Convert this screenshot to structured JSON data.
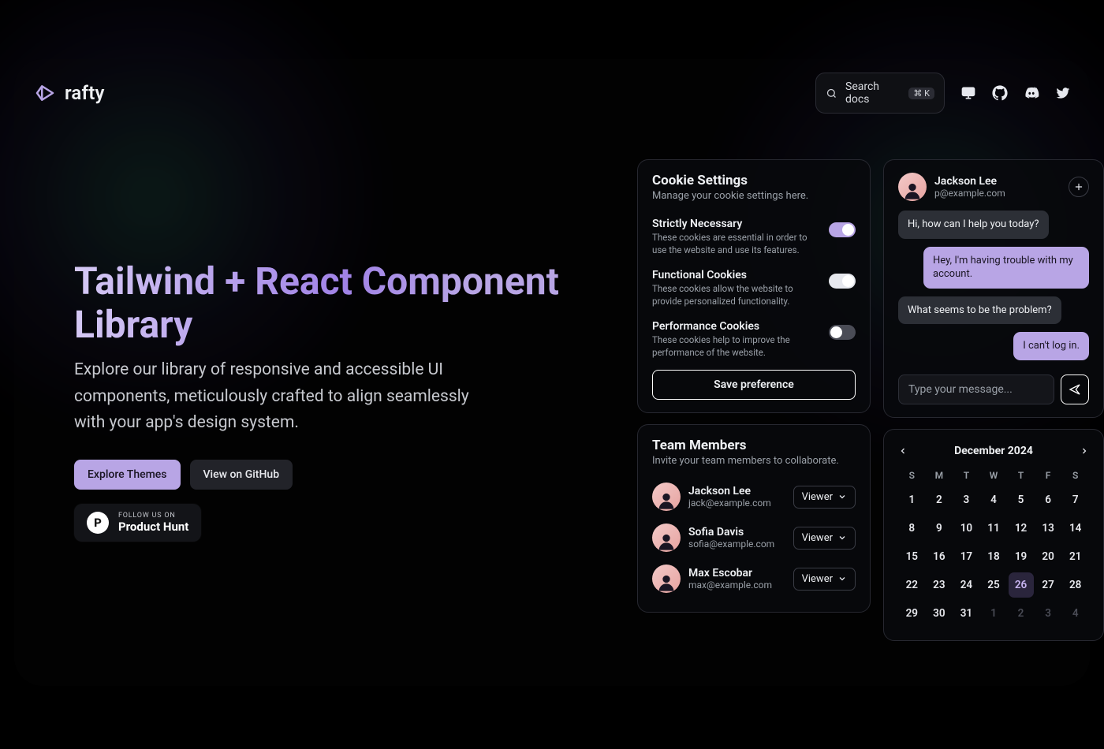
{
  "brand": {
    "name": "rafty"
  },
  "search": {
    "placeholder": "Search docs",
    "shortcut": "⌘ K"
  },
  "hero": {
    "title": "Tailwind + React Component Library",
    "subtitle": "Explore our library of responsive and accessible UI components, meticulously crafted to align seamlessly with your app's design system.",
    "primary_btn": "Explore Themes",
    "secondary_btn": "View on GitHub",
    "ph_follow": "FOLLOW US ON",
    "ph_name": "Product Hunt"
  },
  "cookies": {
    "title": "Cookie Settings",
    "subtitle": "Manage your cookie settings here.",
    "items": [
      {
        "name": "Strictly Necessary",
        "desc": "These cookies are essential in order to use the website and use its features.",
        "on": true,
        "accent": true
      },
      {
        "name": "Functional Cookies",
        "desc": "These cookies allow the website to provide personalized functionality.",
        "on": true,
        "accent": false
      },
      {
        "name": "Performance Cookies",
        "desc": "These cookies help to improve the performance of the website.",
        "on": false,
        "accent": false
      }
    ],
    "save": "Save preference"
  },
  "team": {
    "title": "Team Members",
    "subtitle": "Invite your team members to collaborate.",
    "role_label": "Viewer",
    "members": [
      {
        "name": "Jackson Lee",
        "email": "jack@example.com"
      },
      {
        "name": "Sofia Davis",
        "email": "sofia@example.com"
      },
      {
        "name": "Max Escobar",
        "email": "max@example.com"
      }
    ]
  },
  "chat": {
    "user_name": "Jackson Lee",
    "user_email": "p@example.com",
    "messages": [
      {
        "side": "left",
        "text": "Hi, how can I help you today?"
      },
      {
        "side": "right",
        "text": "Hey, I'm having trouble with my account."
      },
      {
        "side": "left",
        "text": "What seems to be the problem?"
      },
      {
        "side": "right",
        "text": "I can't log in."
      }
    ],
    "input_placeholder": "Type your message..."
  },
  "calendar": {
    "label": "December 2024",
    "dow": [
      "S",
      "M",
      "T",
      "W",
      "T",
      "F",
      "S"
    ],
    "weeks": [
      [
        {
          "d": 1
        },
        {
          "d": 2
        },
        {
          "d": 3
        },
        {
          "d": 4
        },
        {
          "d": 5
        },
        {
          "d": 6
        },
        {
          "d": 7
        }
      ],
      [
        {
          "d": 8
        },
        {
          "d": 9
        },
        {
          "d": 10
        },
        {
          "d": 11
        },
        {
          "d": 12
        },
        {
          "d": 13
        },
        {
          "d": 14
        }
      ],
      [
        {
          "d": 15
        },
        {
          "d": 16
        },
        {
          "d": 17
        },
        {
          "d": 18
        },
        {
          "d": 19
        },
        {
          "d": 20
        },
        {
          "d": 21
        }
      ],
      [
        {
          "d": 22
        },
        {
          "d": 23
        },
        {
          "d": 24
        },
        {
          "d": 25
        },
        {
          "d": 26,
          "today": true
        },
        {
          "d": 27
        },
        {
          "d": 28
        }
      ],
      [
        {
          "d": 29
        },
        {
          "d": 30
        },
        {
          "d": 31
        },
        {
          "d": 1,
          "out": true
        },
        {
          "d": 2,
          "out": true
        },
        {
          "d": 3,
          "out": true
        },
        {
          "d": 4,
          "out": true
        }
      ]
    ]
  }
}
